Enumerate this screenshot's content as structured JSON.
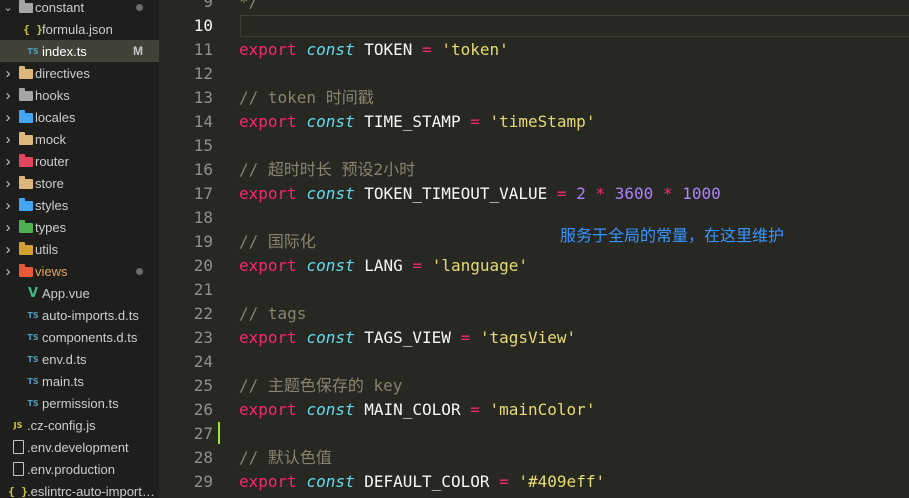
{
  "explorer": {
    "items": [
      {
        "label": "constant",
        "kind": "folder",
        "depth": 0,
        "expanded": true,
        "icon": "folder-icon",
        "color": "#a6a6a6",
        "dot": true,
        "badge": ""
      },
      {
        "label": "formula.json",
        "kind": "json",
        "depth": 1,
        "icon": "json-icon",
        "badge": ""
      },
      {
        "label": "index.ts",
        "kind": "ts",
        "depth": 1,
        "icon": "typescript-icon",
        "badge": "M",
        "active": true
      },
      {
        "label": "directives",
        "kind": "folder",
        "depth": 0,
        "icon": "folder-icon",
        "color": "#dcb67a"
      },
      {
        "label": "hooks",
        "kind": "folder",
        "depth": 0,
        "icon": "folder-icon",
        "color": "#a6a6a6"
      },
      {
        "label": "locales",
        "kind": "folder",
        "depth": 0,
        "icon": "folder-icon",
        "color": "#42a5f5"
      },
      {
        "label": "mock",
        "kind": "folder",
        "depth": 0,
        "icon": "folder-icon",
        "color": "#dcb67a"
      },
      {
        "label": "router",
        "kind": "folder",
        "depth": 0,
        "icon": "folder-icon",
        "color": "#e2465d"
      },
      {
        "label": "store",
        "kind": "folder",
        "depth": 0,
        "icon": "folder-icon",
        "color": "#dcb67a"
      },
      {
        "label": "styles",
        "kind": "folder",
        "depth": 0,
        "icon": "folder-icon",
        "color": "#42a5f5"
      },
      {
        "label": "types",
        "kind": "folder",
        "depth": 0,
        "icon": "folder-icon",
        "color": "#4caf50"
      },
      {
        "label": "utils",
        "kind": "folder",
        "depth": 0,
        "icon": "folder-icon",
        "color": "#d4a032"
      },
      {
        "label": "views",
        "kind": "folder",
        "depth": 0,
        "icon": "folder-icon",
        "color": "#e65a3a",
        "dot": true,
        "highlight": "#e2a55a"
      },
      {
        "label": "App.vue",
        "kind": "vue",
        "depth": 1,
        "icon": "vue-icon"
      },
      {
        "label": "auto-imports.d.ts",
        "kind": "ts",
        "depth": 1,
        "icon": "typescript-icon"
      },
      {
        "label": "components.d.ts",
        "kind": "ts",
        "depth": 1,
        "icon": "typescript-icon"
      },
      {
        "label": "env.d.ts",
        "kind": "ts",
        "depth": 1,
        "icon": "typescript-icon"
      },
      {
        "label": "main.ts",
        "kind": "ts",
        "depth": 1,
        "icon": "typescript-icon"
      },
      {
        "label": "permission.ts",
        "kind": "ts",
        "depth": 1,
        "icon": "typescript-icon"
      },
      {
        "label": ".cz-config.js",
        "kind": "js",
        "depth": 0,
        "icon": "javascript-icon"
      },
      {
        "label": ".env.development",
        "kind": "file",
        "depth": 0,
        "icon": "file-icon"
      },
      {
        "label": ".env.production",
        "kind": "file",
        "depth": 0,
        "icon": "file-icon"
      },
      {
        "label": ".eslintrc-auto-import.json",
        "kind": "json",
        "depth": 0,
        "icon": "json-icon"
      }
    ]
  },
  "editor": {
    "current_line": "10",
    "lines": [
      {
        "n": "9",
        "tokens": [
          {
            "t": "*/",
            "c": "cm"
          }
        ]
      },
      {
        "n": "10",
        "tokens": []
      },
      {
        "n": "11",
        "tokens": [
          {
            "t": "export",
            "c": "kw"
          },
          {
            "t": " "
          },
          {
            "t": "const",
            "c": "st"
          },
          {
            "t": " TOKEN ",
            "c": "vn"
          },
          {
            "t": "=",
            "c": "op"
          },
          {
            "t": " "
          },
          {
            "t": "'token'",
            "c": "str"
          }
        ]
      },
      {
        "n": "12",
        "tokens": []
      },
      {
        "n": "13",
        "tokens": [
          {
            "t": "// token 时间戳",
            "c": "cm"
          }
        ]
      },
      {
        "n": "14",
        "tokens": [
          {
            "t": "export",
            "c": "kw"
          },
          {
            "t": " "
          },
          {
            "t": "const",
            "c": "st"
          },
          {
            "t": " TIME_STAMP ",
            "c": "vn"
          },
          {
            "t": "=",
            "c": "op"
          },
          {
            "t": " "
          },
          {
            "t": "'timeStamp'",
            "c": "str"
          }
        ]
      },
      {
        "n": "15",
        "tokens": []
      },
      {
        "n": "16",
        "tokens": [
          {
            "t": "// 超时时长 预设2小时",
            "c": "cm"
          }
        ]
      },
      {
        "n": "17",
        "tokens": [
          {
            "t": "export",
            "c": "kw"
          },
          {
            "t": " "
          },
          {
            "t": "const",
            "c": "st"
          },
          {
            "t": " TOKEN_TIMEOUT_VALUE ",
            "c": "vn"
          },
          {
            "t": "=",
            "c": "op"
          },
          {
            "t": " "
          },
          {
            "t": "2",
            "c": "num"
          },
          {
            "t": " "
          },
          {
            "t": "*",
            "c": "op"
          },
          {
            "t": " "
          },
          {
            "t": "3600",
            "c": "num"
          },
          {
            "t": " "
          },
          {
            "t": "*",
            "c": "op"
          },
          {
            "t": " "
          },
          {
            "t": "1000",
            "c": "num"
          }
        ]
      },
      {
        "n": "18",
        "tokens": []
      },
      {
        "n": "19",
        "tokens": [
          {
            "t": "// 国际化",
            "c": "cm"
          }
        ]
      },
      {
        "n": "20",
        "tokens": [
          {
            "t": "export",
            "c": "kw"
          },
          {
            "t": " "
          },
          {
            "t": "const",
            "c": "st"
          },
          {
            "t": " LANG ",
            "c": "vn"
          },
          {
            "t": "=",
            "c": "op"
          },
          {
            "t": " "
          },
          {
            "t": "'language'",
            "c": "str"
          }
        ]
      },
      {
        "n": "21",
        "tokens": []
      },
      {
        "n": "22",
        "tokens": [
          {
            "t": "// tags",
            "c": "cm"
          }
        ]
      },
      {
        "n": "23",
        "tokens": [
          {
            "t": "export",
            "c": "kw"
          },
          {
            "t": " "
          },
          {
            "t": "const",
            "c": "st"
          },
          {
            "t": " TAGS_VIEW ",
            "c": "vn"
          },
          {
            "t": "=",
            "c": "op"
          },
          {
            "t": " "
          },
          {
            "t": "'tagsView'",
            "c": "str"
          }
        ]
      },
      {
        "n": "24",
        "tokens": []
      },
      {
        "n": "25",
        "tokens": [
          {
            "t": "// 主题色保存的 key",
            "c": "cm"
          }
        ]
      },
      {
        "n": "26",
        "tokens": [
          {
            "t": "export",
            "c": "kw"
          },
          {
            "t": " "
          },
          {
            "t": "const",
            "c": "st"
          },
          {
            "t": " MAIN_COLOR ",
            "c": "vn"
          },
          {
            "t": "=",
            "c": "op"
          },
          {
            "t": " "
          },
          {
            "t": "'mainColor'",
            "c": "str"
          }
        ]
      },
      {
        "n": "27",
        "tokens": []
      },
      {
        "n": "28",
        "tokens": [
          {
            "t": "// 默认色值",
            "c": "cm"
          }
        ]
      },
      {
        "n": "29",
        "tokens": [
          {
            "t": "export",
            "c": "kw"
          },
          {
            "t": " "
          },
          {
            "t": "const",
            "c": "st"
          },
          {
            "t": " DEFAULT_COLOR ",
            "c": "vn"
          },
          {
            "t": "=",
            "c": "op"
          },
          {
            "t": " "
          },
          {
            "t": "'#409eff'",
            "c": "str"
          }
        ]
      }
    ]
  },
  "annotation": {
    "text": "服务于全局的常量，在这里维护",
    "color": "#3794ff"
  }
}
